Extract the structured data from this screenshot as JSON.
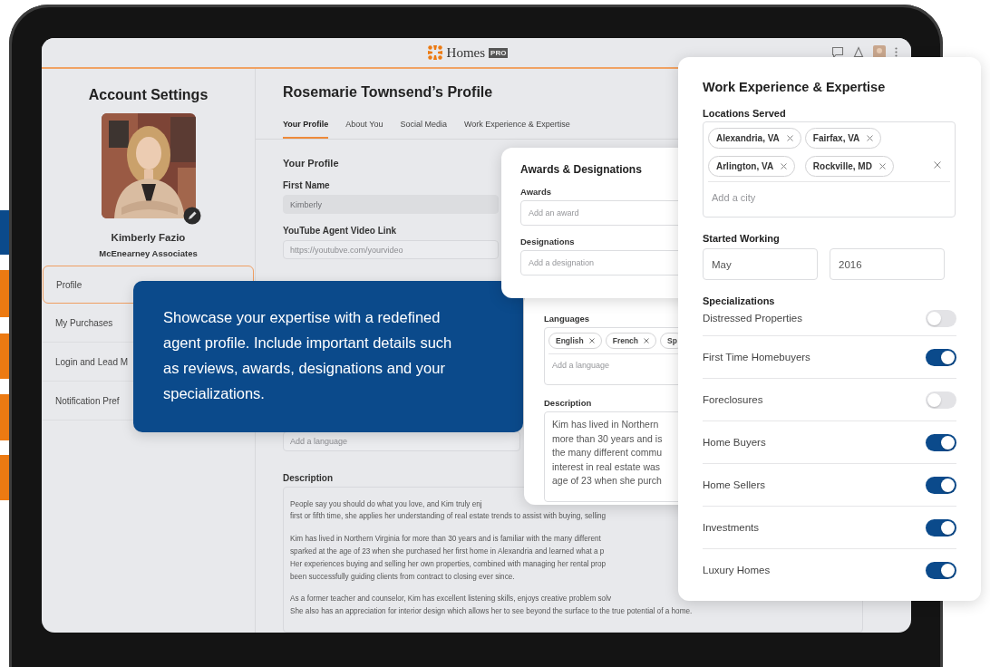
{
  "header": {
    "brand": "Homes",
    "badge": "PRO"
  },
  "sidebar": {
    "title": "Account Settings",
    "name": "Kimberly Fazio",
    "company": "McEnearney Associates",
    "items": [
      {
        "label": "Profile",
        "selected": true
      },
      {
        "label": "My Purchases",
        "selected": false
      },
      {
        "label": "Login and Lead M",
        "selected": false
      },
      {
        "label": "Notification Pref",
        "selected": false
      }
    ]
  },
  "profile": {
    "title": "Rosemarie Townsend’s Profile",
    "tabs": [
      {
        "label": "Your Profile",
        "selected": true
      },
      {
        "label": "About You",
        "selected": false
      },
      {
        "label": "Social Media",
        "selected": false
      },
      {
        "label": "Work Experience & Expertise",
        "selected": false
      }
    ],
    "section_title": "Your Profile",
    "fields": [
      {
        "label": "First Name",
        "value": "Kimberly",
        "disabled": true
      },
      {
        "label": "YouTube Agent Video Link",
        "placeholder": "https://youtubve.com/yourvideo",
        "disabled": false
      }
    ],
    "language_field": {
      "placeholder": "Add a language"
    },
    "description": {
      "label": "Description",
      "paragraphs": [
        [
          "People say you should do what you love, and Kim truly enj",
          "first or fifth time, she applies her understanding of real estate trends to assist with buying, selling"
        ],
        [
          "Kim has lived in Northern Virginia for more than 30 years and is familiar with the many different",
          "sparked at the age of 23 when she purchased her first home in Alexandria and learned what a p",
          "Her experiences buying and selling her own properties, combined with managing her rental prop",
          "been successfully guiding clients from contract to closing ever since."
        ],
        [
          "As a former teacher and counselor, Kim has excellent listening skills, enjoys creative problem solv",
          "She also has an appreciation for interior design which allows her to see beyond the surface to the true potential of a home."
        ]
      ]
    }
  },
  "tooltip": {
    "text": "Showcase your expertise with a redefined agent profile. Include important details such as reviews, awards, designations and your specializations."
  },
  "awards_card": {
    "title": "Awards & Designations",
    "fields": [
      {
        "label": "Awards",
        "placeholder": "Add an award"
      },
      {
        "label": "Designations",
        "placeholder": "Add a designation"
      }
    ]
  },
  "languages_card": {
    "label": "Languages",
    "chips": [
      {
        "label": "English",
        "removable": true
      },
      {
        "label": "French",
        "removable": true
      },
      {
        "label": "Sp",
        "removable": false
      }
    ],
    "placeholder": "Add a language",
    "description_label": "Description",
    "description_lines": [
      "Kim has lived in Northern",
      "more than 30 years and is",
      "the many different commu",
      "interest in real estate was",
      "age of 23 when she purch"
    ]
  },
  "work_card": {
    "title": "Work Experience & Expertise",
    "locations_label": "Locations Served",
    "locations": [
      "Alexandria, VA",
      "Fairfax, VA",
      "Arlington, VA",
      "Rockville, MD"
    ],
    "city_placeholder": "Add a city",
    "started_label": "Started Working",
    "month": "May",
    "year": "2016",
    "specializations_label": "Specializations",
    "specializations": [
      {
        "label": "Distressed Properties",
        "on": false
      },
      {
        "label": "First Time Homebuyers",
        "on": true
      },
      {
        "label": "Foreclosures",
        "on": false
      },
      {
        "label": "Home Buyers",
        "on": true
      },
      {
        "label": "Home Sellers",
        "on": true
      },
      {
        "label": "Investments",
        "on": true
      },
      {
        "label": "Luxury Homes",
        "on": true
      }
    ]
  }
}
